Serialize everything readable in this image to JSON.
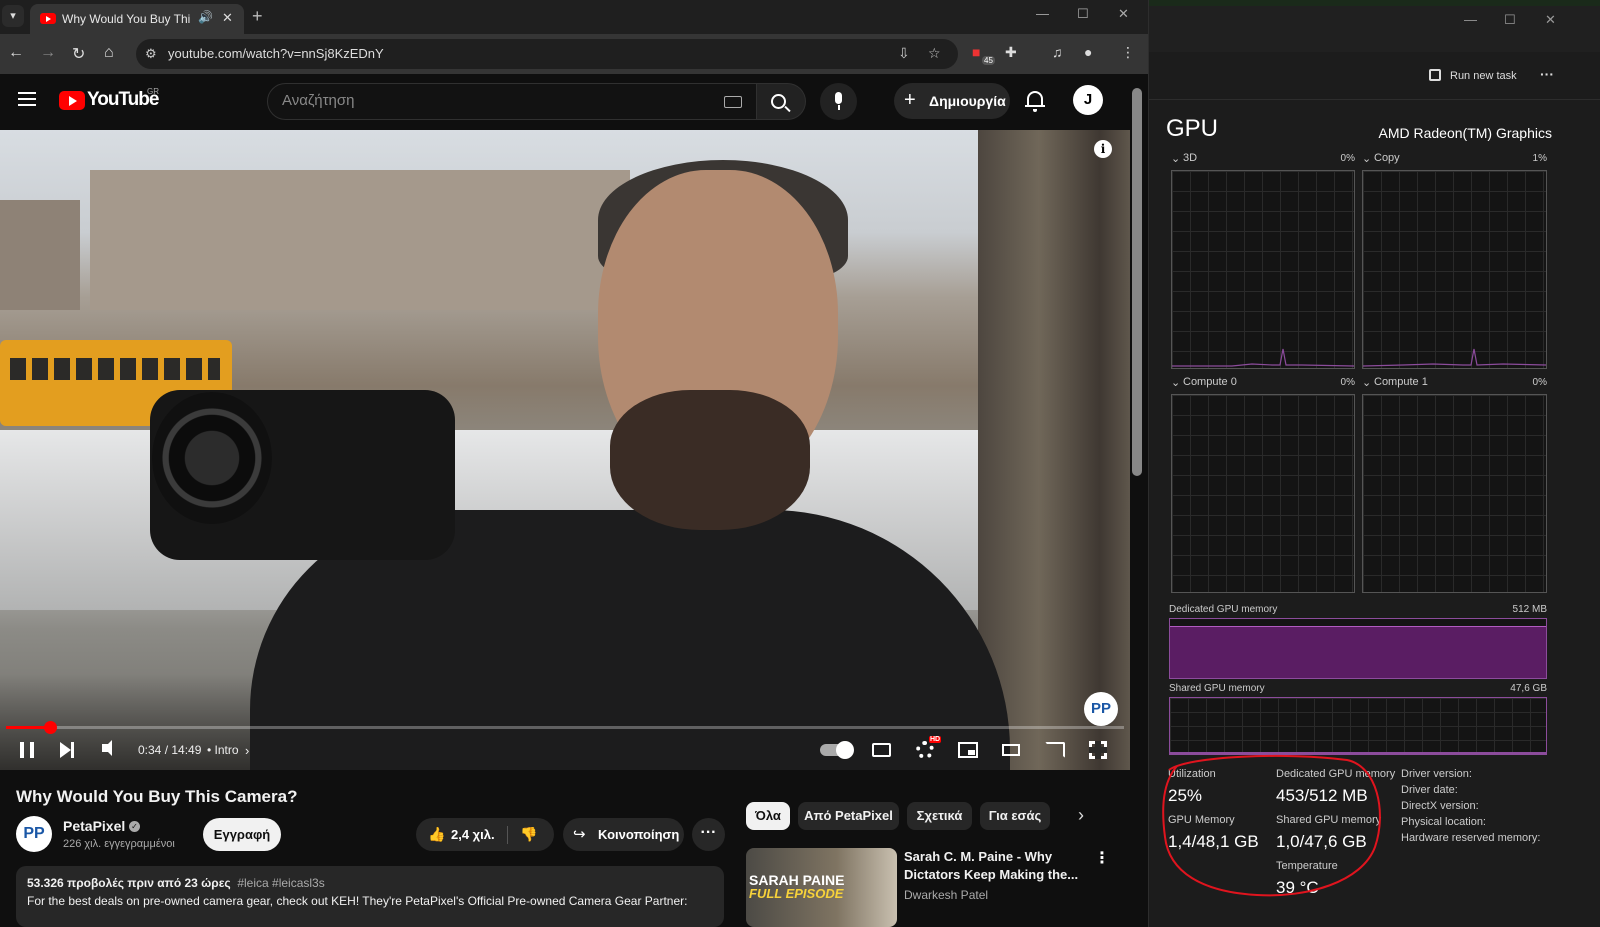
{
  "browser": {
    "tab_title": "Why Would You Buy This Camera?",
    "tab_title_visible": "Why Would You Buy This Ca",
    "url": "youtube.com/watch?v=nnSj8KzEDnY",
    "extension_badge": "45"
  },
  "youtube": {
    "logo_text": "YouTube",
    "country_code": "GR",
    "search_placeholder": "Αναζήτηση",
    "create_label": "Δημιουργία",
    "avatar_letter": "J"
  },
  "player": {
    "time": "0:34 / 14:49",
    "chapter": "• Intro",
    "progress_fraction": 0.039,
    "hd_badge": "HD",
    "channel_watermark": "PP",
    "info_icon": "i"
  },
  "video": {
    "title": "Why Would You Buy This Camera?",
    "channel_name": "PetaPixel",
    "channel_avatar": "PP",
    "subscribers": "226 χιλ. εγγεγραμμένοι",
    "subscribe_label": "Εγγραφή",
    "likes": "2,4 χιλ.",
    "share_label": "Κοινοποίηση",
    "description_meta": "53.326 προβολές  πριν από 23 ώρες",
    "description_tags": "#leica #leicasl3s",
    "description_text": "For the best deals on pre-owned camera gear, check out KEH! They're PetaPixel's Official Pre-owned Camera Gear Partner:"
  },
  "chips": [
    "Όλα",
    "Από PetaPixel",
    "Σχετικά",
    "Για εσάς"
  ],
  "recommendation": {
    "title": "Sarah C. M. Paine - Why Dictators Keep Making the...",
    "channel": "Dwarkesh Patel",
    "thumb_line1": "SARAH PAINE",
    "thumb_line2": "FULL EPISODE"
  },
  "task_manager": {
    "run_new_task": "Run new task",
    "heading": "GPU",
    "gpu_name": "AMD Radeon(TM) Graphics",
    "engines": [
      {
        "name": "3D",
        "percent": "0%"
      },
      {
        "name": "Copy",
        "percent": "1%"
      },
      {
        "name": "Compute 0",
        "percent": "0%"
      },
      {
        "name": "Compute 1",
        "percent": "0%"
      }
    ],
    "dedicated_memory_label": "Dedicated GPU memory",
    "dedicated_memory_max": "512 MB",
    "shared_memory_label": "Shared GPU memory",
    "shared_memory_max": "47,6 GB",
    "stats": {
      "utilization_label": "Utilization",
      "utilization": "25%",
      "dedicated_label": "Dedicated GPU memory",
      "dedicated": "453/512 MB",
      "gpu_memory_label": "GPU Memory",
      "gpu_memory": "1,4/48,1 GB",
      "shared_label": "Shared GPU memory",
      "shared": "1,0/47,6 GB",
      "temperature_label": "Temperature",
      "temperature": "39 °C"
    },
    "info_labels": [
      "Driver version:",
      "Driver date:",
      "DirectX version:",
      "Physical location:",
      "Hardware reserved memory:"
    ],
    "annotation_color": "#e0141e",
    "dedicated_fill_color": "#5a1d63"
  }
}
